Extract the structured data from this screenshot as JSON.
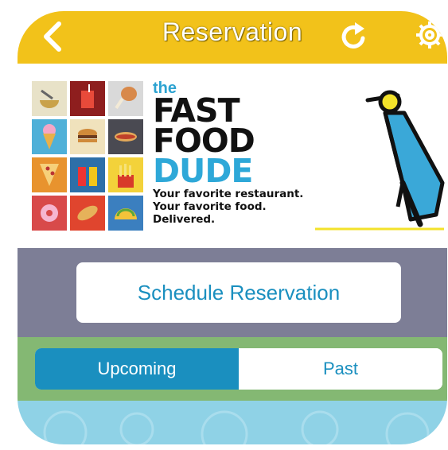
{
  "header": {
    "title": "Reservation",
    "back_icon": "chevron-left-icon",
    "refresh_icon": "refresh-icon",
    "settings_icon": "gear-icon",
    "background_color": "#f2c21a"
  },
  "banner": {
    "brand": {
      "the": "the",
      "line1": "FAST",
      "line2": "FOOD",
      "line3": "DUDE"
    },
    "tagline": {
      "line1": "Your favorite restaurant.",
      "line2": "Your favorite food.",
      "line3": "Delivered."
    },
    "tile_icons": [
      "bowl-icon",
      "drink-icon",
      "chicken-leg-icon",
      "ice-cream-icon",
      "burger-icon",
      "hotdog-icon",
      "pizza-icon",
      "condiments-icon",
      "fries-icon",
      "donut-icon",
      "sandwich-icon",
      "taco-icon"
    ],
    "illustration": "scooter-icon"
  },
  "actions": {
    "schedule_label": "Schedule Reservation"
  },
  "tabs": {
    "items": [
      {
        "label": "Upcoming",
        "active": true
      },
      {
        "label": "Past",
        "active": false
      }
    ]
  },
  "colors": {
    "accent": "#1a8fbf",
    "gray_band": "#7d7e96",
    "green_band": "#84b873",
    "bottom_band": "#8fd2e6"
  }
}
